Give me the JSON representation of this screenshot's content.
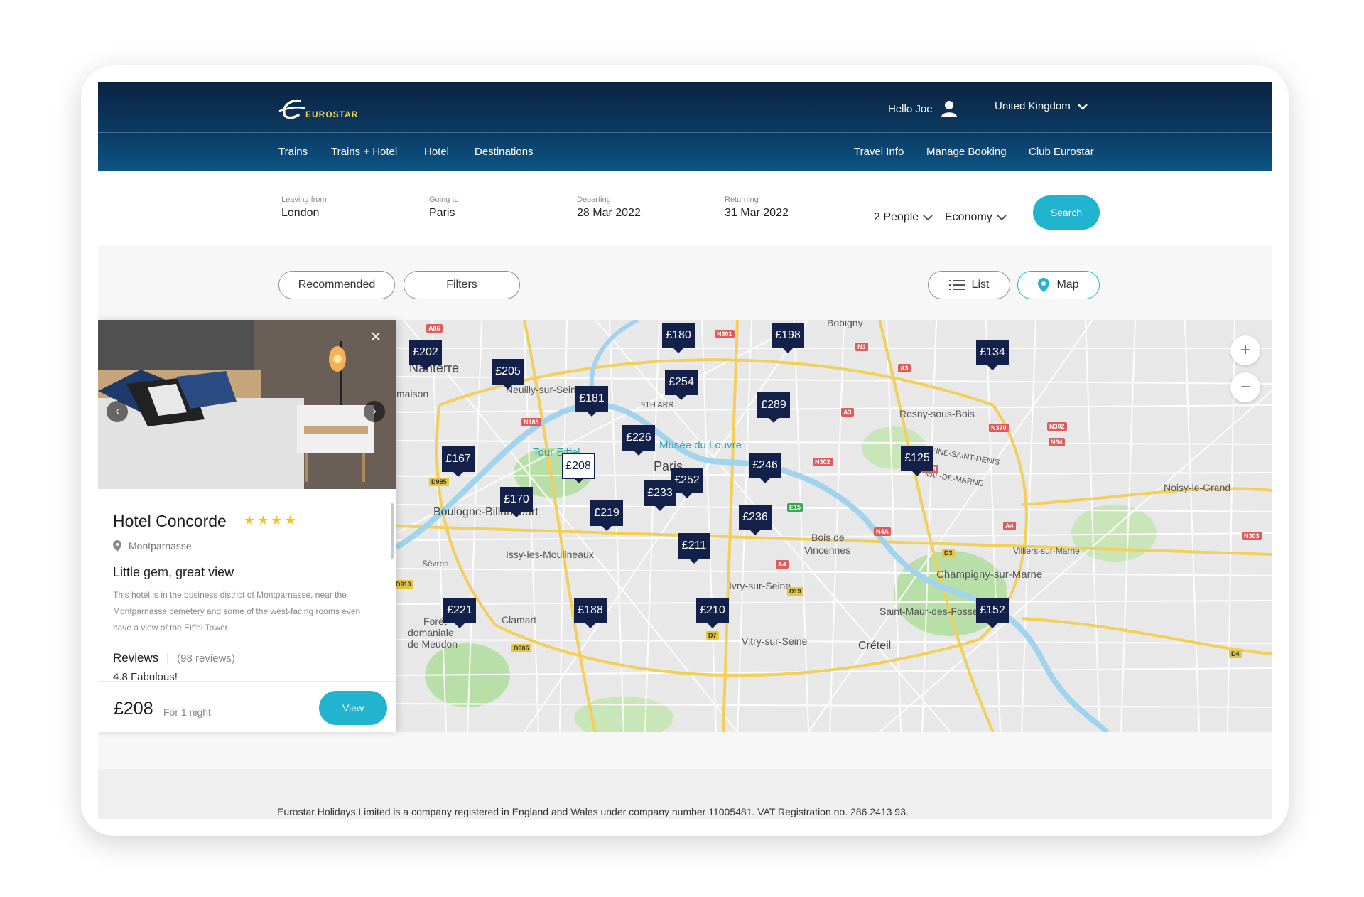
{
  "header": {
    "logo_text": "EUROSTAR",
    "greeting": "Hello Joe",
    "country": "United Kingdom",
    "nav_left": [
      "Trains",
      "Trains + Hotel",
      "Hotel",
      "Destinations"
    ],
    "nav_right": [
      "Travel Info",
      "Manage Booking",
      "Club Eurostar"
    ]
  },
  "search": {
    "leaving_label": "Leaving from",
    "leaving_value": "London",
    "going_label": "Going to",
    "going_value": "Paris",
    "departing_label": "Departing",
    "departing_value": "28 Mar 2022",
    "returning_label": "Returning",
    "returning_value": "31 Mar 2022",
    "people": "2 People",
    "class": "Economy",
    "search_label": "Search"
  },
  "toolbar": {
    "recommended": "Recommended",
    "filters": "Filters",
    "list": "List",
    "map": "Map"
  },
  "map": {
    "places": [
      "Bobigny",
      "Nanterre",
      "Neuilly-sur-Seine",
      "9TH ARR.",
      "Rosny-sous-Bois",
      "Paris",
      "Tour Eiffel",
      "Musée du Louvre",
      "SEINE-SAINT-DENIS",
      "VAL-DE-MARNE",
      "Noisy-le-Grand",
      "Boulogne-Billancourt",
      "Bois de",
      "Vincennes",
      "Issy-les-Moulineaux",
      "Sèvres",
      "Ivry-sur-Seine",
      "Villiers-sur-Marne",
      "Champigny-sur-Marne",
      "Forêt",
      "domaniale",
      "de Meudon",
      "Clamart",
      "Vitry-sur-Seine",
      "Saint-Maur-des-Fossés",
      "Créteil",
      "maison"
    ],
    "roads": [
      "A86",
      "N301",
      "N3",
      "A3",
      "N185",
      "A3",
      "N370",
      "N302",
      "N34",
      "D985",
      "N302",
      "A86",
      "E15",
      "N4A",
      "A4",
      "D3",
      "N303",
      "D910",
      "D19",
      "A4",
      "D7",
      "D906",
      "D4"
    ],
    "prices": [
      "£202",
      "£205",
      "£180",
      "£198",
      "£134",
      "£254",
      "£181",
      "£289",
      "£226",
      "£167",
      "£208",
      "£252",
      "£246",
      "£125",
      "£233",
      "£170",
      "£219",
      "£236",
      "£211",
      "£221",
      "£188",
      "£210",
      "£152"
    ],
    "zoom_in": "+",
    "zoom_out": "−"
  },
  "hotel": {
    "name": "Hotel Concorde",
    "stars": "★★★★",
    "location": "Montparnasse",
    "tagline": "Little gem, great view",
    "description": "This hotel is in the business district of Montparnasse, near the Montparnasse cemetery and some of the west-facing rooms even have a view of the Eiffel Tower.",
    "reviews_label": "Reviews",
    "reviews_count": "(98 reviews)",
    "score": "4.8 Fabulous!",
    "price": "£208",
    "per": "For 1 night",
    "view_label": "View"
  },
  "footer": {
    "legal": "Eurostar Holidays Limited is a company registered in England and Wales under company number 11005481. VAT Registration no. 286 2413 93."
  },
  "colors": {
    "accent": "#22b3cf",
    "marker": "#13214a",
    "header_top": "#0a2340",
    "header_bottom": "#0b5585",
    "star": "#f4c21a"
  }
}
